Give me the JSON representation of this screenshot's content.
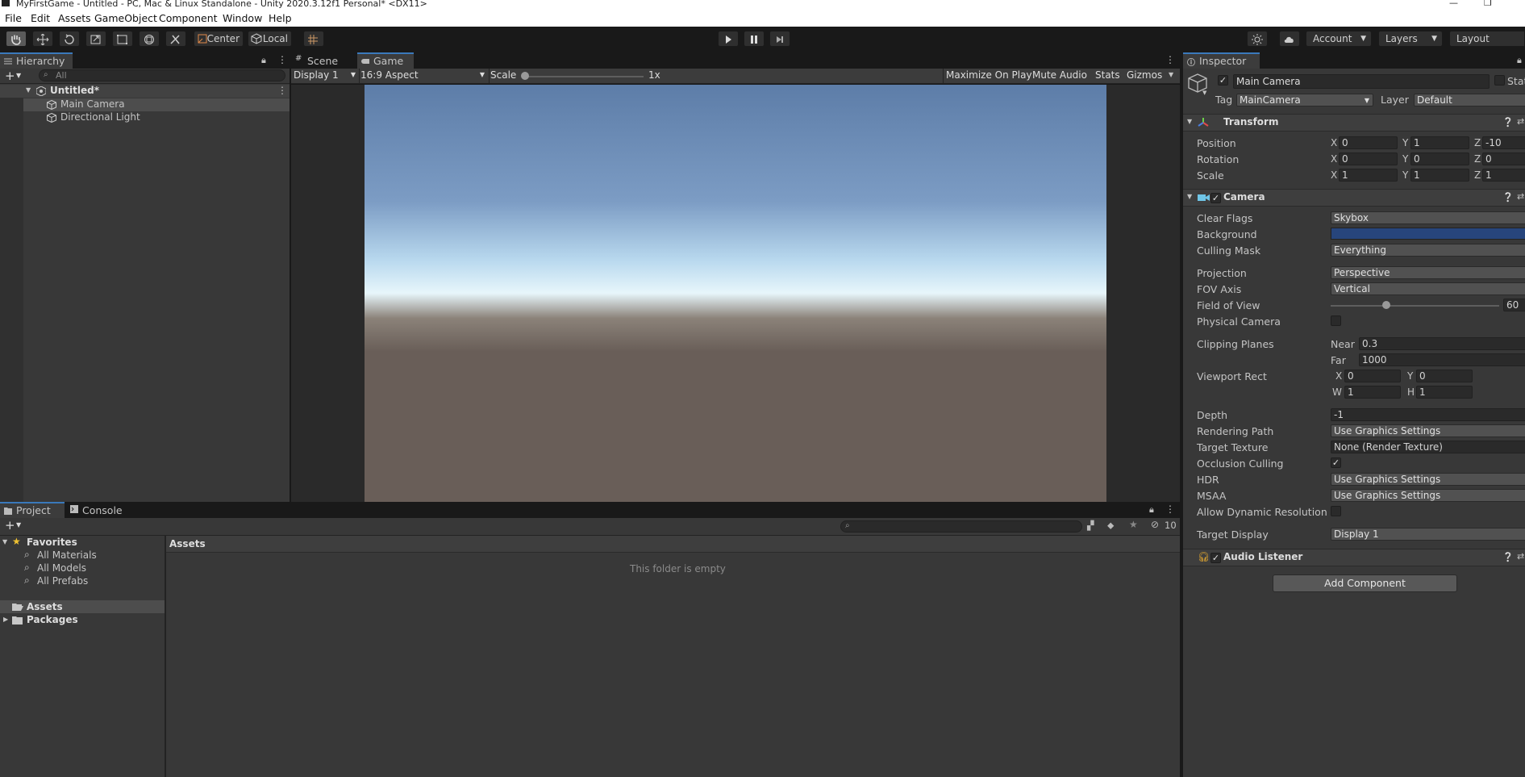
{
  "window": {
    "title": "MyFirstGame - Untitled - PC, Mac & Linux Standalone - Unity 2020.3.12f1 Personal* <DX11>"
  },
  "menu": [
    "File",
    "Edit",
    "Assets",
    "GameObject",
    "Component",
    "Window",
    "Help"
  ],
  "toolbar": {
    "pivot": "Center",
    "space": "Local",
    "account": "Account",
    "layers": "Layers",
    "layout": "Layout"
  },
  "hierarchy": {
    "tab": "Hierarchy",
    "search_placeholder": "All",
    "scene": "Untitled*",
    "items": [
      "Main Camera",
      "Directional Light"
    ]
  },
  "game_view": {
    "tabs": [
      "Scene",
      "Game"
    ],
    "display": "Display 1",
    "aspect": "16:9 Aspect",
    "scale_label": "Scale",
    "scale_value": "1x",
    "maximize": "Maximize On Play",
    "mute": "Mute Audio",
    "stats": "Stats",
    "gizmos": "Gizmos",
    "sky_colors": {
      "top": "#5d7da8",
      "horizon": "#e7f6fb",
      "ground": "#695e58"
    }
  },
  "project": {
    "tabs": [
      "Project",
      "Console"
    ],
    "favorites_label": "Favorites",
    "favorites": [
      "All Materials",
      "All Models",
      "All Prefabs"
    ],
    "tree": [
      "Assets",
      "Packages"
    ],
    "breadcrumb": "Assets",
    "empty_message": "This folder is empty",
    "hidden_count": "10"
  },
  "inspector": {
    "tab": "Inspector",
    "object_name": "Main Camera",
    "static_label": "Stat",
    "tag_label": "Tag",
    "tag": "MainCamera",
    "layer_label": "Layer",
    "layer": "Default",
    "transform": {
      "title": "Transform",
      "rows": [
        {
          "label": "Position",
          "x": "0",
          "y": "1",
          "z": "-10"
        },
        {
          "label": "Rotation",
          "x": "0",
          "y": "0",
          "z": "0"
        },
        {
          "label": "Scale",
          "x": "1",
          "y": "1",
          "z": "1"
        }
      ]
    },
    "camera": {
      "title": "Camera",
      "clear_flags_label": "Clear Flags",
      "clear_flags": "Skybox",
      "background_label": "Background",
      "background_color": "#27457c",
      "culling_mask_label": "Culling Mask",
      "culling_mask": "Everything",
      "projection_label": "Projection",
      "projection": "Perspective",
      "fov_axis_label": "FOV Axis",
      "fov_axis": "Vertical",
      "fov_label": "Field of View",
      "fov": "60",
      "fov_fraction": 0.33,
      "physical_label": "Physical Camera",
      "clipping_label": "Clipping Planes",
      "near_label": "Near",
      "near": "0.3",
      "far_label": "Far",
      "far": "1000",
      "viewport_label": "Viewport Rect",
      "vx": "0",
      "vy": "0",
      "vw": "1",
      "vh": "1",
      "depth_label": "Depth",
      "depth": "-1",
      "rendering_path_label": "Rendering Path",
      "rendering_path": "Use Graphics Settings",
      "target_texture_label": "Target Texture",
      "target_texture": "None (Render Texture)",
      "occlusion_label": "Occlusion Culling",
      "hdr_label": "HDR",
      "hdr": "Use Graphics Settings",
      "msaa_label": "MSAA",
      "msaa": "Use Graphics Settings",
      "dynamic_res_label": "Allow Dynamic Resolution",
      "target_display_label": "Target Display",
      "target_display": "Display 1"
    },
    "audio_listener": {
      "title": "Audio Listener"
    },
    "add_component": "Add Component"
  }
}
